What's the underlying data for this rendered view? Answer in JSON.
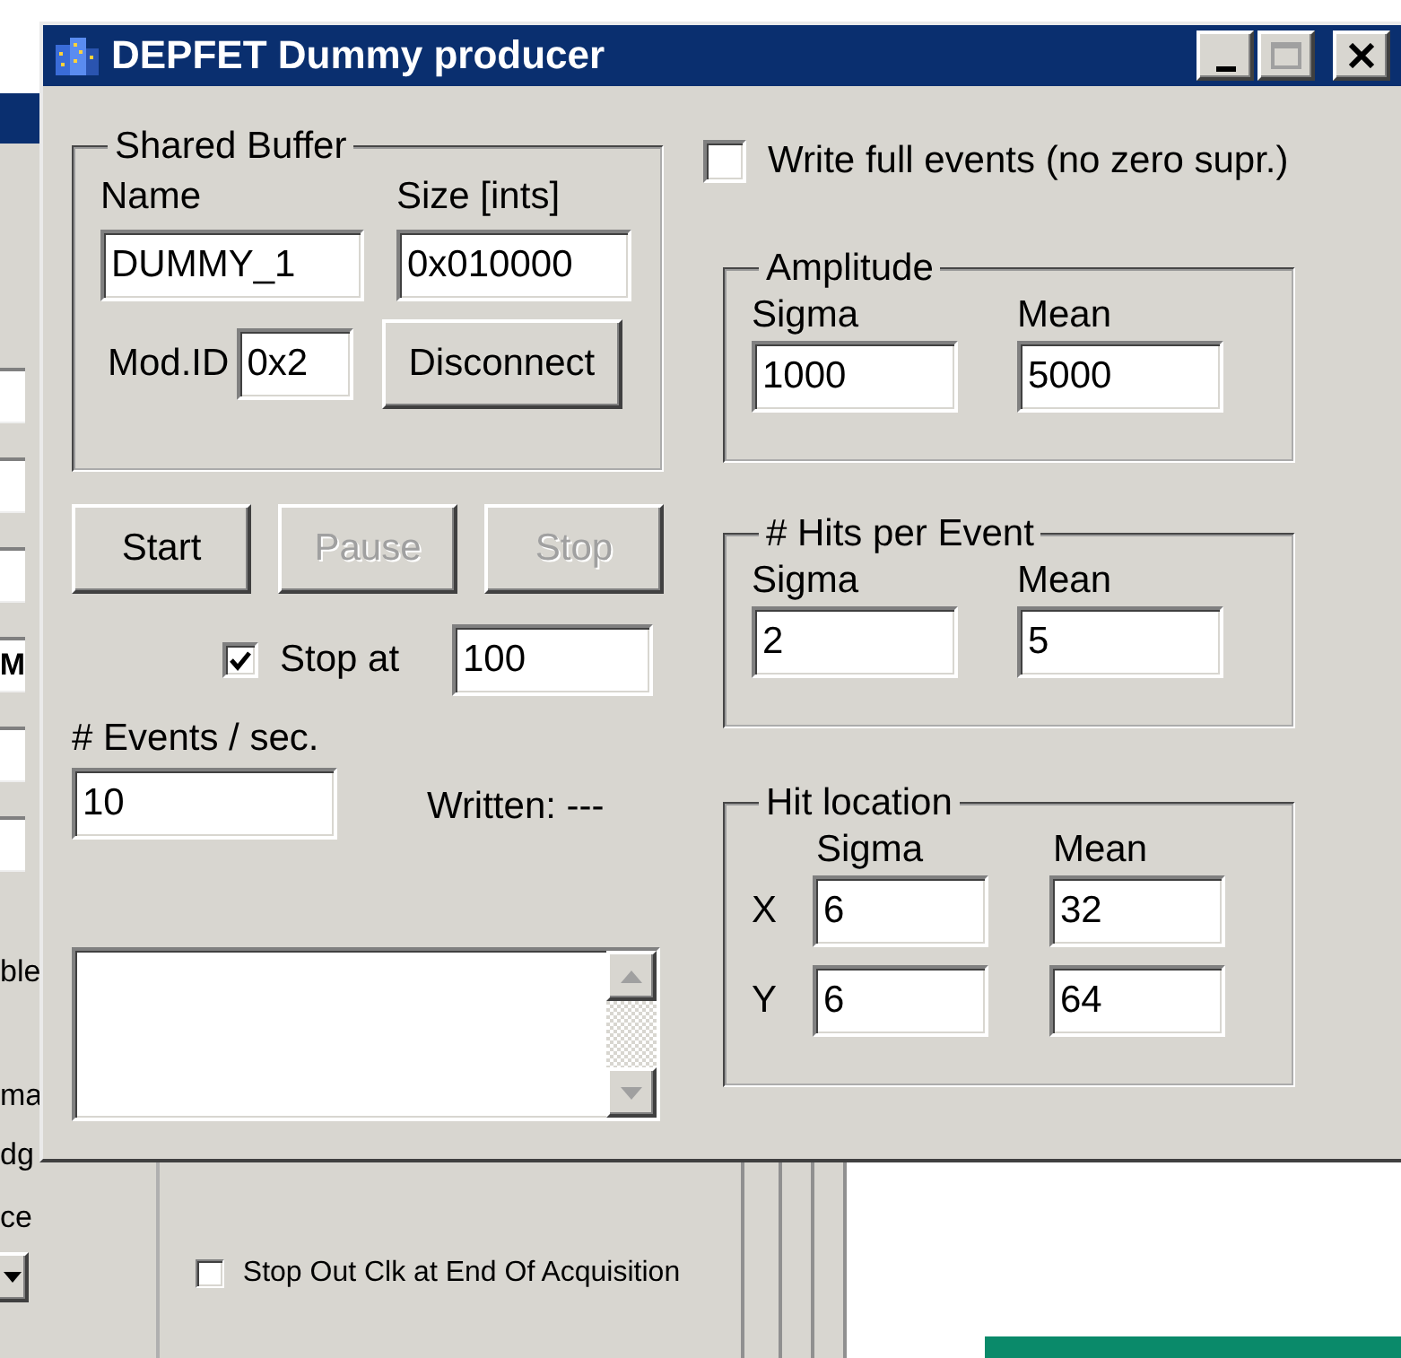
{
  "window": {
    "title": "DEPFET Dummy producer",
    "buttons": [
      {
        "kind": "minimize",
        "disabled": false
      },
      {
        "kind": "maximize",
        "disabled": true
      },
      {
        "kind": "close",
        "disabled": false
      }
    ]
  },
  "shared_buffer": {
    "title": "Shared Buffer",
    "name_label": "Name",
    "name_value": "DUMMY_1",
    "size_label": "Size [ints]",
    "size_value": "0x010000",
    "mod_id_label": "Mod.ID",
    "mod_id_value": "0x2",
    "button": "Disconnect"
  },
  "run_buttons": [
    {
      "label": "Start",
      "disabled": false
    },
    {
      "label": "Pause",
      "disabled": true
    },
    {
      "label": "Stop",
      "disabled": true
    }
  ],
  "stop_at": {
    "label": "Stop at",
    "checked": true,
    "value": "100"
  },
  "events_per_sec": {
    "label": "# Events / sec.",
    "value": "10"
  },
  "written": "Written: ---",
  "write_full_events": {
    "label": "Write full events (no zero supr.)",
    "checked": false
  },
  "amplitude": {
    "title": "Amplitude",
    "columns": [
      "Sigma",
      "Mean"
    ],
    "values": [
      "1000",
      "5000"
    ]
  },
  "hits_per_event": {
    "title": "# Hits per Event",
    "columns": [
      "Sigma",
      "Mean"
    ],
    "values": [
      "2",
      "5"
    ]
  },
  "hit_location": {
    "title": "Hit location",
    "columns": [
      "Sigma",
      "Mean"
    ],
    "rows": [
      {
        "label": "X",
        "values": [
          "6",
          "32"
        ]
      },
      {
        "label": "Y",
        "values": [
          "6",
          "64"
        ]
      }
    ]
  },
  "background_window": {
    "field_text": "M",
    "fragments": [
      "ble",
      "ma",
      "dg",
      "ce"
    ],
    "checkbox": {
      "label": "Stop Out Clk at End Of Acquisition",
      "checked": false
    }
  }
}
